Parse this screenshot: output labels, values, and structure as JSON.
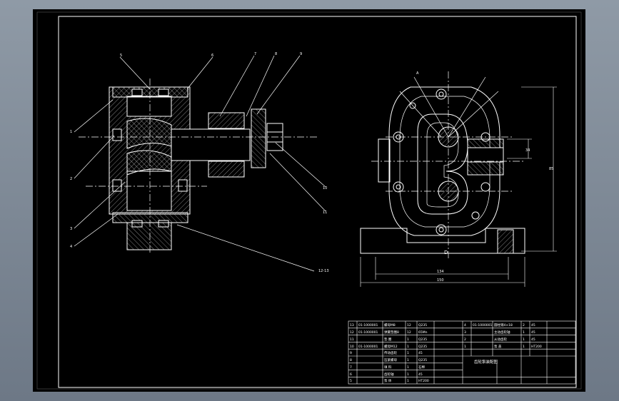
{
  "drawing": {
    "title_block": {
      "name_cell": "齿轮泵装配图",
      "parts": [
        {
          "no": "13",
          "code": "01-1000001",
          "name": "螺母M8",
          "qty": "12",
          "material": "Q235"
        },
        {
          "no": "12",
          "code": "01-1000001",
          "name": "弹簧垫圈8",
          "qty": "12",
          "material": "65Mn"
        },
        {
          "no": "11",
          "code": "",
          "name": "垫 圈",
          "qty": "1",
          "material": "Q235"
        },
        {
          "no": "10",
          "code": "01-1000001",
          "name": "螺母M12",
          "qty": "1",
          "material": "Q235"
        },
        {
          "no": "9",
          "code": "",
          "name": "传动齿轮",
          "qty": "1",
          "material": "45"
        },
        {
          "no": "8",
          "code": "",
          "name": "压紧螺母",
          "qty": "1",
          "material": "Q235"
        },
        {
          "no": "7",
          "code": "",
          "name": "填 料",
          "qty": "1",
          "material": "石棉"
        },
        {
          "no": "6",
          "code": "",
          "name": "齿轮轴",
          "qty": "1",
          "material": "45"
        },
        {
          "no": "5",
          "code": "",
          "name": "泵 体",
          "qty": "1",
          "material": "HT200"
        }
      ],
      "parts_right": [
        {
          "no": "4",
          "code": "01-1000001",
          "name": "圆柱销4×18",
          "qty": "2",
          "material": "45"
        },
        {
          "no": "3",
          "code": "",
          "name": "主动齿轮轴",
          "qty": "1",
          "material": "45"
        },
        {
          "no": "2",
          "code": "",
          "name": "从动齿轮",
          "qty": "1",
          "material": "45"
        },
        {
          "no": "1",
          "code": "",
          "name": "泵 盖",
          "qty": "1",
          "material": "HT200"
        }
      ]
    },
    "callouts_front": [
      "5",
      "6",
      "7",
      "8",
      "9",
      "1",
      "2",
      "3",
      "4",
      "10",
      "11",
      "12-13"
    ],
    "dims_side": {
      "width_inner": "134",
      "width_outer": "150",
      "height": "85",
      "bore": "34",
      "label_d": "D",
      "label_a": "A"
    }
  }
}
